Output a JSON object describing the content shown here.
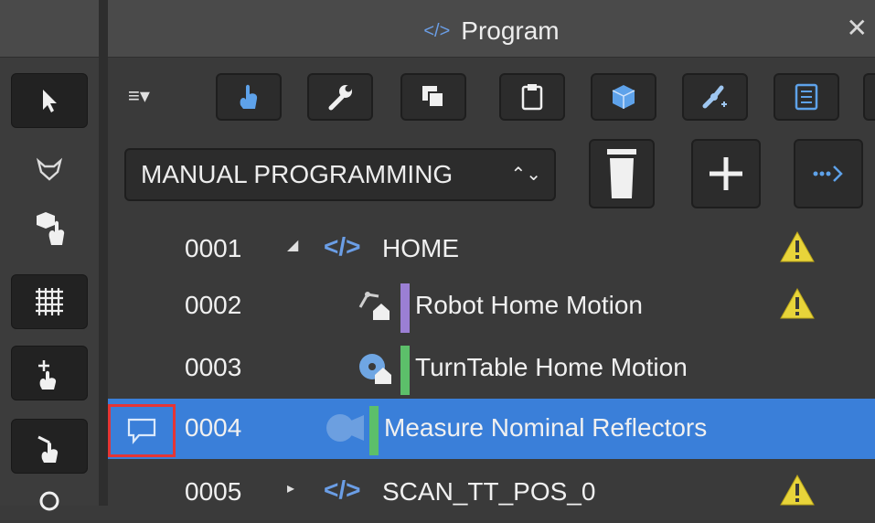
{
  "panel": {
    "title": "Program",
    "title_icon": "code-icon",
    "close_glyph": "✕"
  },
  "toolbar": {
    "menu_label": "≡▾",
    "buttons": [
      "hand-icon",
      "wrench-icon",
      "copy-icon",
      "clipboard-icon",
      "cube-icon",
      "robot-arm-icon",
      "list-icon"
    ]
  },
  "mode_select": {
    "value": "MANUAL PROGRAMMING",
    "arrows": "⌃⌄"
  },
  "action_buttons": [
    "trash-icon",
    "plus-icon",
    "insert-after-icon"
  ],
  "rows": [
    {
      "num": "0001",
      "name": "HOME",
      "expander": "◢",
      "type_icon": "code-icon",
      "warning": true,
      "bar_color": null,
      "selected": false
    },
    {
      "num": "0002",
      "name": "Robot Home Motion",
      "type_icon": "robot-home-icon",
      "warning": true,
      "bar_color": "#9b7fd4",
      "selected": false
    },
    {
      "num": "0003",
      "name": "TurnTable Home Motion",
      "type_icon": "turntable-home-icon",
      "warning": false,
      "bar_color": "#5cbf6a",
      "selected": false
    },
    {
      "num": "0004",
      "name": "Measure Nominal Reflectors",
      "type_icon": "camera-icon",
      "warning": false,
      "bar_color": "#5cbf6a",
      "selected": true,
      "comment_icon": "comment-icon"
    },
    {
      "num": "0005",
      "name": "SCAN_TT_POS_0",
      "expander": "▸",
      "type_icon": "code-icon",
      "warning": true,
      "bar_color": null,
      "selected": false
    }
  ],
  "side_tools": [
    "pointer-icon",
    "fox-icon",
    "cube-hand-icon",
    "grid-icon",
    "move-hand-icon",
    "hand-pointer-icon"
  ],
  "colors": {
    "accent": "#3a7fd9",
    "panel_bg": "#3a3a3a",
    "warning": "#e8d43a",
    "highlight": "#e53535"
  }
}
